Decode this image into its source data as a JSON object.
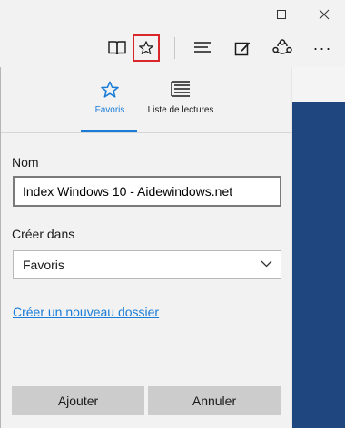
{
  "toolbar": {
    "reading_view_icon": "book-icon",
    "favorites_icon": "star-icon",
    "hub_icon": "hub-icon",
    "note_icon": "note-icon",
    "share_icon": "share-icon",
    "more_label": "···"
  },
  "hub": {
    "tabs": [
      {
        "label": "Favoris",
        "icon": "star-icon",
        "active": true
      },
      {
        "label": "Liste de lectures",
        "icon": "reading-list-icon",
        "active": false
      }
    ]
  },
  "form": {
    "name_label": "Nom",
    "name_value": "Index Windows 10 - Aidewindows.net",
    "create_in_label": "Créer dans",
    "create_in_value": "Favoris",
    "new_folder_link": "Créer un nouveau dossier",
    "add_button": "Ajouter",
    "cancel_button": "Annuler"
  },
  "colors": {
    "accent": "#1a7cd6",
    "highlight": "#d9262a",
    "page_blue": "#1f467e"
  }
}
